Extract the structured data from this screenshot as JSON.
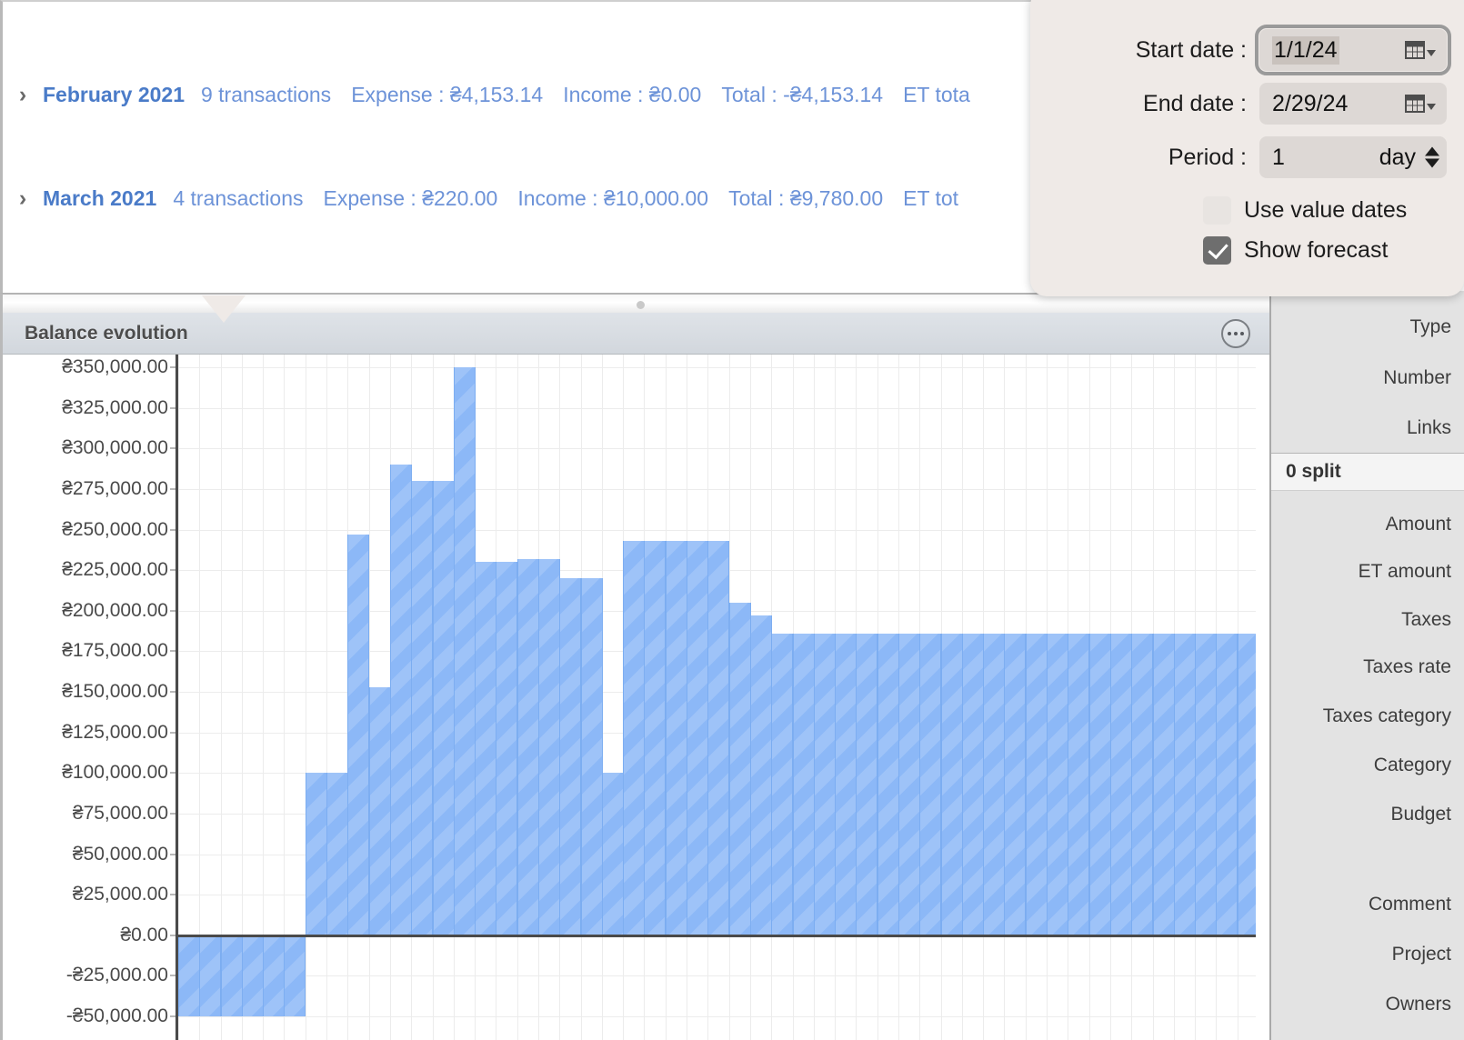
{
  "transactions": {
    "rows": [
      {
        "disclosure": "›",
        "month": "February 2021",
        "count": "9 transactions",
        "expense": "Expense : ₴4,153.14",
        "income": "Income : ₴0.00",
        "total": "Total : -₴4,153.14",
        "et_total": "ET tota"
      },
      {
        "disclosure": "›",
        "month": "March 2021",
        "count": "4 transactions",
        "expense": "Expense : ₴220.00",
        "income": "Income : ₴10,000.00",
        "total": "Total : ₴9,780.00",
        "et_total": "ET tot"
      }
    ]
  },
  "chart_panel": {
    "title": "Balance evolution",
    "more_button": "more-options"
  },
  "popover": {
    "start_date_label": "Start date :",
    "start_date_value": "1/1/24",
    "end_date_label": "End date :",
    "end_date_value": "2/29/24",
    "period_label": "Period :",
    "period_value": "1",
    "period_unit": "day",
    "use_value_dates_label": "Use value dates",
    "use_value_dates_checked": false,
    "show_forecast_label": "Show forecast",
    "show_forecast_checked": true
  },
  "sidebar": {
    "fields_top": [
      "Type",
      "Number",
      "Links"
    ],
    "split_header": "0 split",
    "fields_mid": [
      "Amount",
      "ET amount",
      "Taxes",
      "Taxes rate",
      "Taxes category",
      "Category",
      "Budget"
    ],
    "fields_bottom": [
      "Comment",
      "Project",
      "Owners"
    ]
  },
  "chart_data": {
    "type": "bar",
    "title": "Balance evolution",
    "xlabel": "",
    "ylabel": "",
    "currency_symbol": "₴",
    "ylim": [
      -50000,
      350000
    ],
    "ytick_step": 25000,
    "grid": true,
    "legend": false,
    "ytick_labels": [
      "₴350,000.00",
      "₴325,000.00",
      "₴300,000.00",
      "₴275,000.00",
      "₴250,000.00",
      "₴225,000.00",
      "₴200,000.00",
      "₴175,000.00",
      "₴150,000.00",
      "₴125,000.00",
      "₴100,000.00",
      "₴75,000.00",
      "₴50,000.00",
      "₴25,000.00",
      "₴0.00",
      "-₴25,000.00",
      "-₴50,000.00"
    ],
    "ytick_values": [
      350000,
      325000,
      300000,
      275000,
      250000,
      225000,
      200000,
      175000,
      150000,
      125000,
      100000,
      75000,
      50000,
      25000,
      0,
      -25000,
      -50000
    ],
    "bar_count": 51,
    "values": [
      -50000,
      -50000,
      -50000,
      -50000,
      -50000,
      -50000,
      100000,
      100000,
      247000,
      153000,
      290000,
      280000,
      280000,
      350000,
      230000,
      230000,
      232000,
      232000,
      220000,
      220000,
      100000,
      243000,
      243000,
      243000,
      243000,
      243000,
      205000,
      197000,
      186000,
      186000,
      186000,
      186000,
      186000,
      186000,
      186000,
      186000,
      186000,
      186000,
      186000,
      186000,
      186000,
      186000,
      186000,
      186000,
      186000,
      186000,
      186000,
      186000,
      186000,
      186000,
      186000
    ]
  }
}
